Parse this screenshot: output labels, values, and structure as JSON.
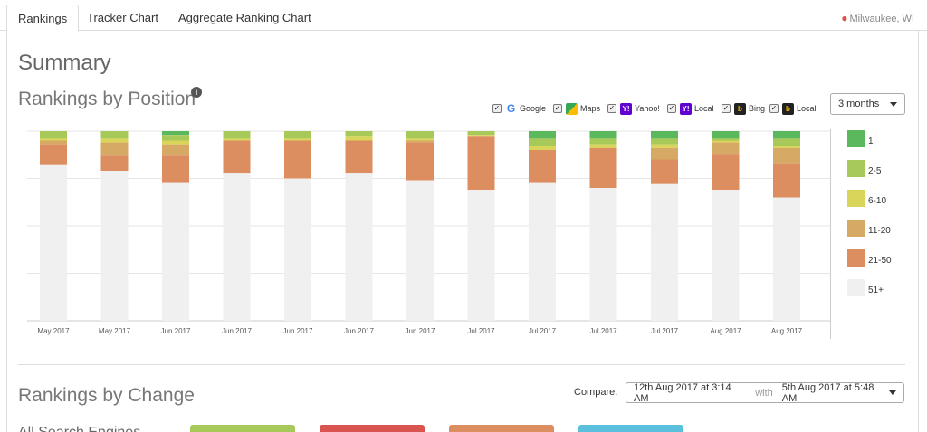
{
  "tabs": [
    {
      "label": "Rankings"
    },
    {
      "label": "Tracker Chart"
    },
    {
      "label": "Aggregate Ranking Chart"
    }
  ],
  "location": "Milwaukee, WI",
  "summary_title": "Summary",
  "position_section": {
    "title": "Rankings by Position",
    "info_icon": "i",
    "engines": [
      {
        "label": "Google",
        "icon": "google-icon",
        "checked": true
      },
      {
        "label": "Maps",
        "icon": "google-maps-icon",
        "checked": true
      },
      {
        "label": "Yahoo!",
        "icon": "yahoo-icon",
        "checked": true
      },
      {
        "label": "Local",
        "icon": "yahoo-local-icon",
        "checked": true
      },
      {
        "label": "Bing",
        "icon": "bing-icon",
        "checked": true
      },
      {
        "label": "Local",
        "icon": "bing-local-icon",
        "checked": true
      }
    ],
    "range_select": "3 months"
  },
  "chart_data": {
    "type": "bar",
    "stacked": true,
    "categories": [
      "May 2017",
      "May 2017",
      "Jun 2017",
      "Jun 2017",
      "Jun 2017",
      "Jun 2017",
      "Jun 2017",
      "Jul 2017",
      "Jul 2017",
      "Jul 2017",
      "Jul 2017",
      "Aug 2017",
      "Aug 2017"
    ],
    "series": [
      {
        "name": "1",
        "color": "#5cb85c",
        "values": [
          0,
          0,
          2,
          0,
          0,
          0,
          0,
          0,
          4,
          4,
          4,
          4,
          4
        ]
      },
      {
        "name": "2-5",
        "color": "#a7c95a",
        "values": [
          4,
          4,
          3,
          4,
          4,
          3,
          4,
          2,
          4,
          3,
          3,
          1,
          4
        ]
      },
      {
        "name": "6-10",
        "color": "#d9d55b",
        "values": [
          1,
          2,
          2,
          1,
          1,
          2,
          1,
          1,
          2,
          2,
          2,
          1,
          1
        ]
      },
      {
        "name": "11-20",
        "color": "#d6a965",
        "values": [
          2,
          7,
          6,
          0,
          0,
          0,
          1,
          0,
          0,
          0,
          6,
          6,
          8
        ]
      },
      {
        "name": "21-50",
        "color": "#dc8e61",
        "values": [
          11,
          8,
          14,
          17,
          20,
          17,
          20,
          28,
          17,
          21,
          13,
          19,
          18
        ]
      },
      {
        "name": "51+",
        "color": "#f0f0f0",
        "values": [
          82,
          79,
          73,
          78,
          75,
          78,
          74,
          69,
          73,
          70,
          72,
          69,
          65
        ]
      }
    ],
    "ylim": [
      0,
      100
    ],
    "grid": true,
    "legend_position": "right"
  },
  "change_section": {
    "title": "Rankings by Change",
    "compare_label": "Compare:",
    "compare_from": "12th Aug 2017 at 3:14 AM",
    "compare_with": "with",
    "compare_to": "5th Aug 2017 at 5:48 AM",
    "cut_label": "All Search Engines"
  }
}
